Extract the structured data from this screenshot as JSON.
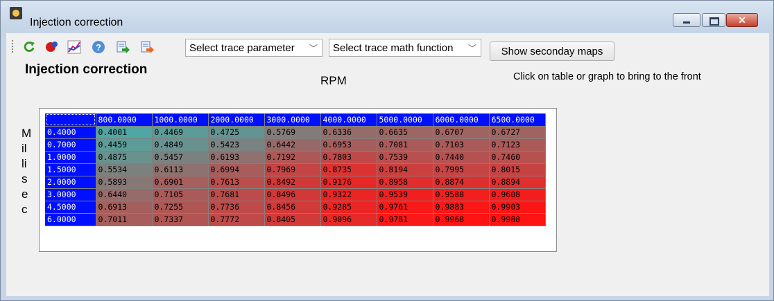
{
  "window": {
    "title": "Injection correction"
  },
  "toolbar": {
    "icons": [
      "refresh-icon",
      "record-icon",
      "chart-edit-icon",
      "help-icon",
      "import-icon",
      "export-icon"
    ],
    "trace_parameter": "Select trace parameter",
    "trace_math_function": "Select trace math function",
    "secondary_maps_label": "Show seconday maps"
  },
  "main": {
    "heading": "Injection correction",
    "x_axis_label": "RPM",
    "hint": "Click on table or graph to bring to the front",
    "y_axis_label": [
      "M",
      "il",
      "li",
      "s",
      "e",
      "c"
    ]
  },
  "table": {
    "columns": [
      "800.0000",
      "1000.0000",
      "2000.0000",
      "3000.0000",
      "4000.0000",
      "5000.0000",
      "6000.0000",
      "6500.0000"
    ],
    "rows": [
      {
        "label": "0.4000",
        "values": [
          "0.4001",
          "0.4469",
          "0.4725",
          "0.5769",
          "0.6336",
          "0.6635",
          "0.6707",
          "0.6727"
        ]
      },
      {
        "label": "0.7000",
        "values": [
          "0.4459",
          "0.4849",
          "0.5423",
          "0.6442",
          "0.6953",
          "0.7081",
          "0.7103",
          "0.7123"
        ]
      },
      {
        "label": "1.0000",
        "values": [
          "0.4875",
          "0.5457",
          "0.6193",
          "0.7192",
          "0.7803",
          "0.7539",
          "0.7440",
          "0.7460"
        ]
      },
      {
        "label": "1.5000",
        "values": [
          "0.5534",
          "0.6113",
          "0.6994",
          "0.7969",
          "0.8735",
          "0.8194",
          "0.7995",
          "0.8015"
        ]
      },
      {
        "label": "2.0000",
        "values": [
          "0.5893",
          "0.6901",
          "0.7613",
          "0.8492",
          "0.9176",
          "0.8958",
          "0.8874",
          "0.8894"
        ]
      },
      {
        "label": "3.0000",
        "values": [
          "0.6440",
          "0.7105",
          "0.7681",
          "0.8496",
          "0.9322",
          "0.9539",
          "0.9588",
          "0.9608"
        ]
      },
      {
        "label": "4.5000",
        "values": [
          "0.6913",
          "0.7255",
          "0.7736",
          "0.8456",
          "0.9285",
          "0.9761",
          "0.9883",
          "0.9903"
        ]
      },
      {
        "label": "6.0000",
        "values": [
          "0.7011",
          "0.7337",
          "0.7772",
          "0.8405",
          "0.9096",
          "0.9781",
          "0.9968",
          "0.9988"
        ]
      }
    ],
    "colors": {
      "header": "#0010ff",
      "low": "#4fa6a3",
      "high": "#ff1414"
    }
  }
}
